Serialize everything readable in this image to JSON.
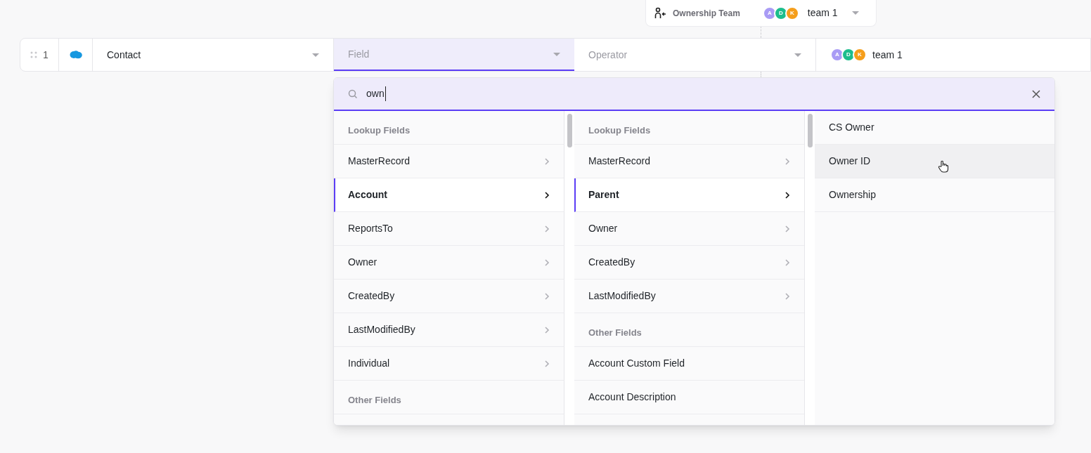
{
  "team_card": {
    "label": "Ownership Team",
    "avatars": [
      {
        "initial": "A",
        "color": "#a99bf5"
      },
      {
        "initial": "D",
        "color": "#1cbd8c"
      },
      {
        "initial": "K",
        "color": "#f59e1b"
      }
    ],
    "value": "team 1"
  },
  "row": {
    "number": "1",
    "object": "Contact",
    "field": {
      "placeholder": "Field",
      "selected": true
    },
    "operator": {
      "placeholder": "Operator"
    },
    "value": {
      "avatars": [
        {
          "initial": "A",
          "color": "#a99bf5"
        },
        {
          "initial": "D",
          "color": "#1cbd8c"
        },
        {
          "initial": "K",
          "color": "#f59e1b"
        }
      ],
      "text": "team 1"
    }
  },
  "dropdown": {
    "search": {
      "value": "own"
    },
    "columns": [
      {
        "items": [
          {
            "kind": "header",
            "label": "Lookup Fields"
          },
          {
            "kind": "item",
            "label": "MasterRecord",
            "has_children": true,
            "selected": false
          },
          {
            "kind": "item",
            "label": "Account",
            "has_children": true,
            "selected": true
          },
          {
            "kind": "item",
            "label": "ReportsTo",
            "has_children": true,
            "selected": false
          },
          {
            "kind": "item",
            "label": "Owner",
            "has_children": true,
            "selected": false
          },
          {
            "kind": "item",
            "label": "CreatedBy",
            "has_children": true,
            "selected": false
          },
          {
            "kind": "item",
            "label": "LastModifiedBy",
            "has_children": true,
            "selected": false
          },
          {
            "kind": "item",
            "label": "Individual",
            "has_children": true,
            "selected": false
          },
          {
            "kind": "header",
            "label": "Other Fields"
          }
        ]
      },
      {
        "items": [
          {
            "kind": "header",
            "label": "Lookup Fields"
          },
          {
            "kind": "item",
            "label": "MasterRecord",
            "has_children": true,
            "selected": false
          },
          {
            "kind": "item",
            "label": "Parent",
            "has_children": true,
            "selected": true
          },
          {
            "kind": "item",
            "label": "Owner",
            "has_children": true,
            "selected": false
          },
          {
            "kind": "item",
            "label": "CreatedBy",
            "has_children": true,
            "selected": false
          },
          {
            "kind": "item",
            "label": "LastModifiedBy",
            "has_children": true,
            "selected": false
          },
          {
            "kind": "header",
            "label": "Other Fields"
          },
          {
            "kind": "item",
            "label": "Account Custom Field",
            "has_children": false,
            "selected": false
          },
          {
            "kind": "item",
            "label": "Account Description",
            "has_children": false,
            "selected": false
          }
        ]
      },
      {
        "items": [
          {
            "kind": "item",
            "label": "CS Owner",
            "has_children": false,
            "selected": false
          },
          {
            "kind": "item",
            "label": "Owner ID",
            "has_children": false,
            "selected": true
          },
          {
            "kind": "item",
            "label": "Ownership",
            "has_children": false,
            "selected": false
          }
        ]
      }
    ]
  }
}
